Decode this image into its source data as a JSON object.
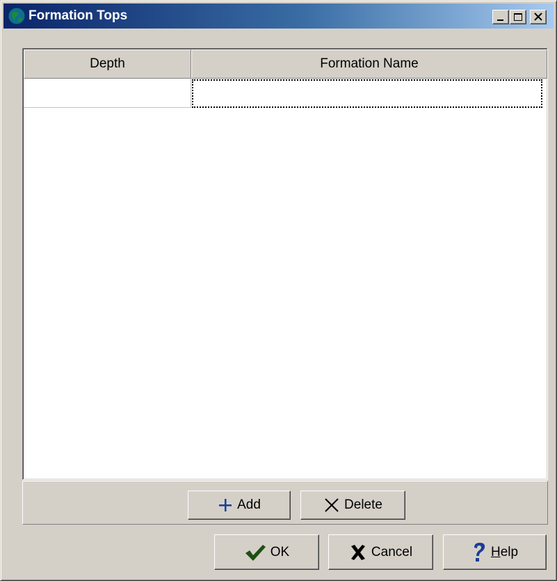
{
  "window": {
    "title": "Formation Tops",
    "icon": "globe-icon"
  },
  "title_buttons": {
    "minimize": "minimize-icon",
    "maximize": "maximize-icon",
    "close": "close-icon"
  },
  "grid": {
    "columns": [
      "Depth",
      "Formation Name"
    ],
    "rows": [
      {
        "depth": "",
        "formation_name": ""
      }
    ]
  },
  "toolbar": {
    "add_label": "Add",
    "delete_label": "Delete"
  },
  "footer": {
    "ok_label": "OK",
    "cancel_label": "Cancel",
    "help_label_prefix": "",
    "help_label_mnemonic": "H",
    "help_label_rest": "elp"
  },
  "colors": {
    "titlebar_start": "#0a246a",
    "titlebar_end": "#a6caf0",
    "face": "#d4d0c8",
    "add_icon": "#1a3d99",
    "ok_icon": "#1f4f12",
    "help_icon": "#1a3d99"
  }
}
